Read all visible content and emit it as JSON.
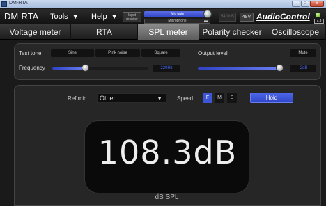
{
  "window": {
    "title": "DM-RTA",
    "controls": [
      "–",
      "□",
      "x"
    ]
  },
  "menubar": {
    "brand": "DM-RTA",
    "tools": "Tools",
    "help": "Help",
    "input_monitor": "Input monitor",
    "mic_gain_label": "Mic gain",
    "mic_source": "Microphone",
    "db_readout": "54.9dB",
    "phantom_48v": "48V",
    "logo_text": "AudioControl",
    "battery": "7.3"
  },
  "tabs": [
    {
      "label": "Voltage meter",
      "active": false
    },
    {
      "label": "RTA",
      "active": false
    },
    {
      "label": "SPL meter",
      "active": true
    },
    {
      "label": "Polarity checker",
      "active": false
    },
    {
      "label": "Oscilloscope",
      "active": false
    }
  ],
  "test_tone": {
    "label": "Test tone",
    "options": [
      "Sine",
      "Pink noise",
      "Square"
    ],
    "frequency_label": "Frequency",
    "frequency_value": "220Hz",
    "output_level_label": "Output level",
    "output_level_value": "-2dB",
    "mute_label": "Mute"
  },
  "spl": {
    "ref_mic_label": "Ref mic",
    "ref_mic_value": "Other",
    "speed_label": "Speed",
    "speed_options": [
      "F",
      "M",
      "S"
    ],
    "speed_selected": "F",
    "hold_label": "Hold",
    "value": "108.3dB",
    "unit": "dB SPL"
  },
  "colors": {
    "accent": "#3c56d6",
    "background": "#1a1a1a",
    "panel": "#262626"
  }
}
